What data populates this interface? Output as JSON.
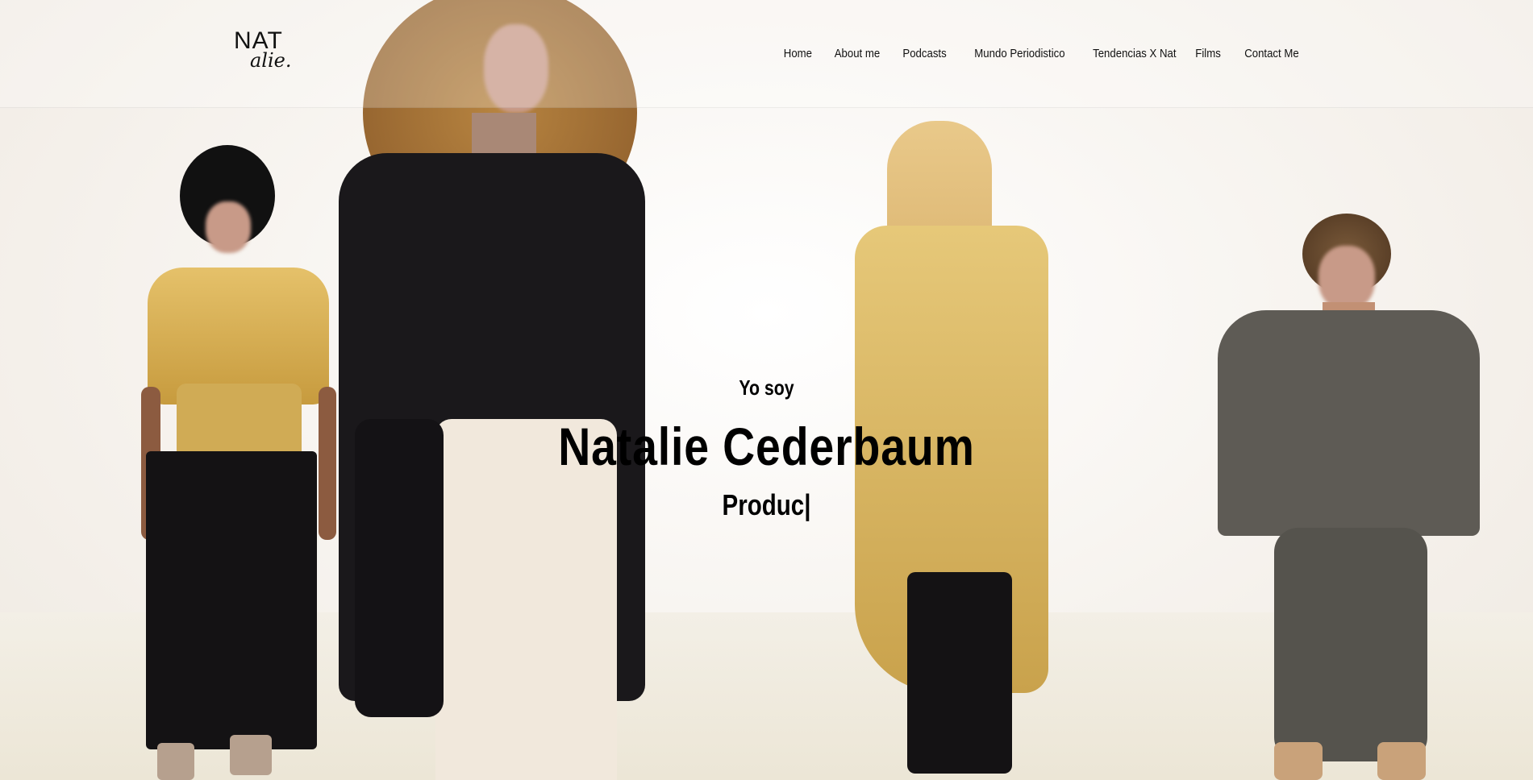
{
  "brand": {
    "logo_top": "NAT",
    "logo_script": "alie."
  },
  "nav": {
    "items": [
      "Home",
      "About me",
      "Podcasts",
      "Mundo Periodistico",
      "Tendencias X Nat",
      "Films",
      "Contact Me"
    ]
  },
  "hero": {
    "greeting": "Yo soy",
    "name": "Natalie Cederbaum",
    "role_typing": "Produc|"
  },
  "colors": {
    "background": "#f5f1ec",
    "text": "#000000",
    "gold": "#d8b155",
    "black": "#151315",
    "gray": "#5d5a52"
  }
}
